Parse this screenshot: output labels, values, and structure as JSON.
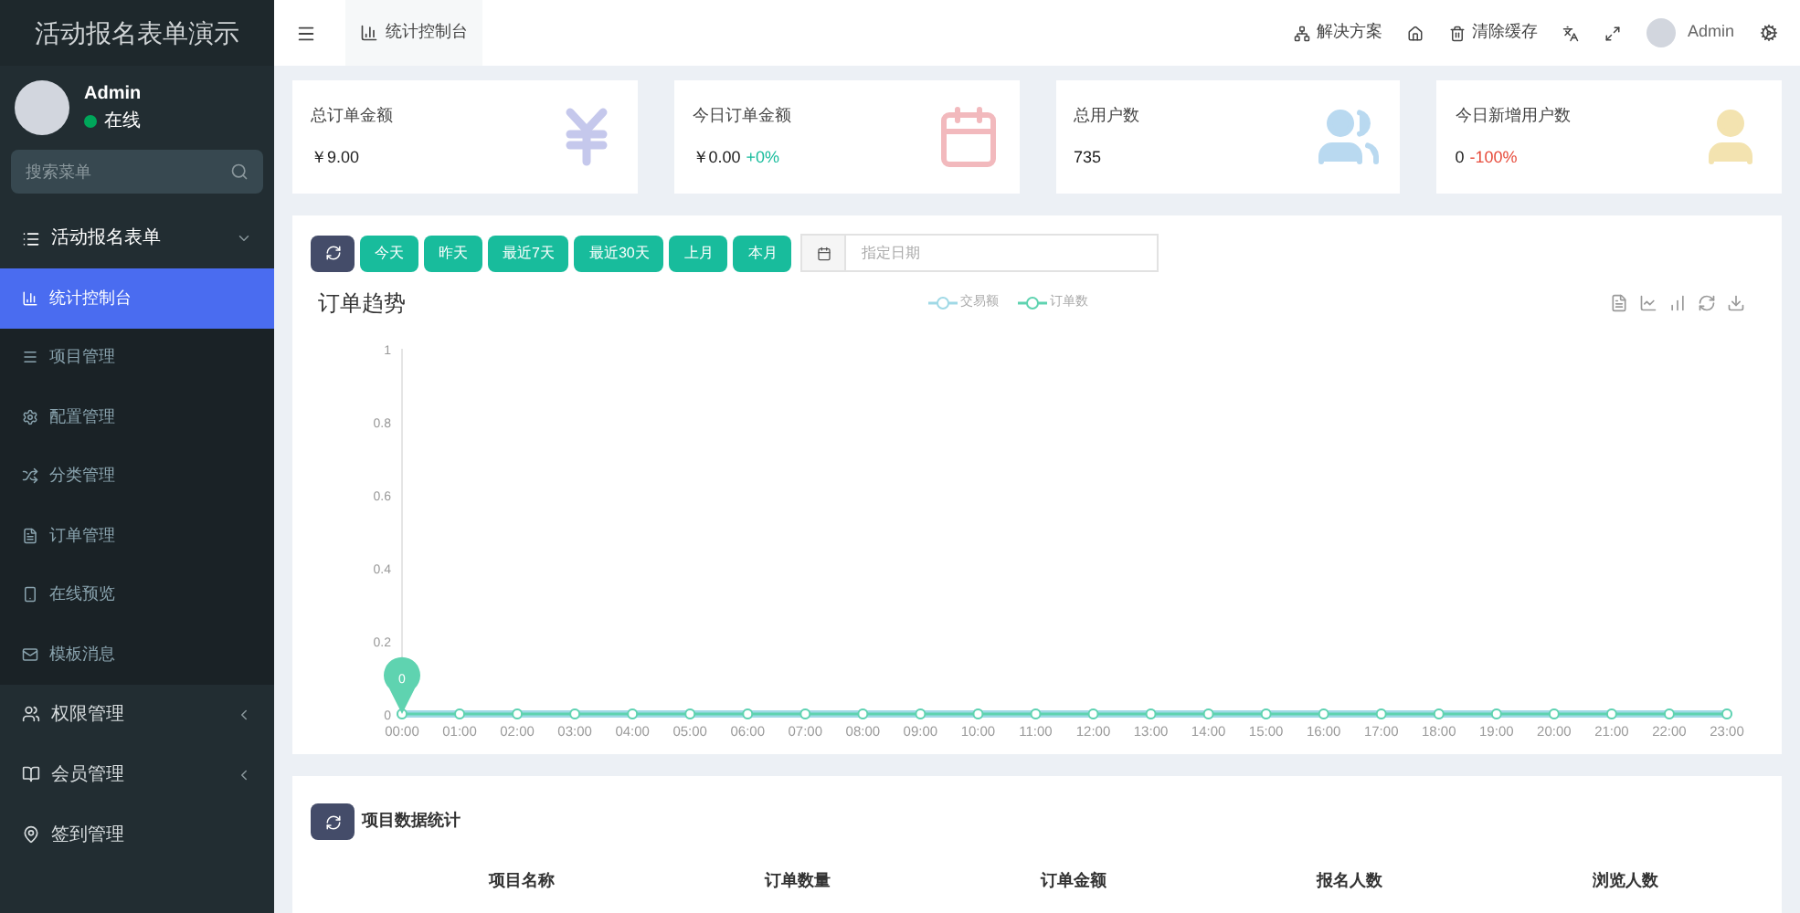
{
  "sidebar": {
    "title": "活动报名表单演示",
    "user": {
      "name": "Admin",
      "status": "在线"
    },
    "search": {
      "placeholder": "搜索菜单"
    },
    "menu": [
      {
        "label": "活动报名表单",
        "expanded": true,
        "children": [
          {
            "label": "统计控制台",
            "selected": true
          },
          {
            "label": "项目管理",
            "selected": false
          },
          {
            "label": "配置管理",
            "selected": false
          },
          {
            "label": "分类管理",
            "selected": false
          },
          {
            "label": "订单管理",
            "selected": false
          },
          {
            "label": "在线预览",
            "selected": false
          },
          {
            "label": "模板消息",
            "selected": false
          }
        ]
      },
      {
        "label": "权限管理",
        "expanded": false
      },
      {
        "label": "会员管理",
        "expanded": false
      },
      {
        "label": "签到管理"
      }
    ]
  },
  "topbar": {
    "tab": "统计控制台",
    "actions": [
      "解决方案",
      "清除缓存"
    ],
    "user": "Admin"
  },
  "stats": [
    {
      "label": "总订单金额",
      "value": "￥9.00"
    },
    {
      "label": "今日订单金额",
      "value": "￥0.00",
      "change": "+0%",
      "color": "#18bc9c"
    },
    {
      "label": "总用户数",
      "value": "735"
    },
    {
      "label": "今日新增用户数",
      "value": "0",
      "change": "-100%",
      "color": "#e74c3c"
    }
  ],
  "filters": {
    "buttons": [
      "今天",
      "昨天",
      "最近7天",
      "最近30天",
      "上月",
      "本月"
    ],
    "date_placeholder": "指定日期"
  },
  "chart": {
    "title": "订单趋势",
    "chart_data": {
      "type": "line",
      "categories": [
        "00:00",
        "01:00",
        "02:00",
        "03:00",
        "04:00",
        "05:00",
        "06:00",
        "07:00",
        "08:00",
        "09:00",
        "10:00",
        "11:00",
        "12:00",
        "13:00",
        "14:00",
        "15:00",
        "16:00",
        "17:00",
        "18:00",
        "19:00",
        "20:00",
        "21:00",
        "22:00",
        "23:00"
      ],
      "series": [
        {
          "name": "交易额",
          "color": "#a0d9e6",
          "marker": "circle",
          "values": [
            0,
            0,
            0,
            0,
            0,
            0,
            0,
            0,
            0,
            0,
            0,
            0,
            0,
            0,
            0,
            0,
            0,
            0,
            0,
            0,
            0,
            0,
            0,
            0
          ]
        },
        {
          "name": "订单数",
          "color": "#5fd3b0",
          "marker": "circle",
          "values": [
            0,
            0,
            0,
            0,
            0,
            0,
            0,
            0,
            0,
            0,
            0,
            0,
            0,
            0,
            0,
            0,
            0,
            0,
            0,
            0,
            0,
            0,
            0,
            0
          ]
        }
      ],
      "ylim": [
        0,
        1
      ],
      "yticks": [
        0,
        0.2,
        0.4,
        0.6,
        0.8,
        1
      ],
      "annotations": [
        "0"
      ]
    }
  },
  "project_stats": {
    "title": "项目数据统计",
    "columns": [
      "项目名称",
      "订单数量",
      "订单金额",
      "报名人数",
      "浏览人数"
    ]
  }
}
